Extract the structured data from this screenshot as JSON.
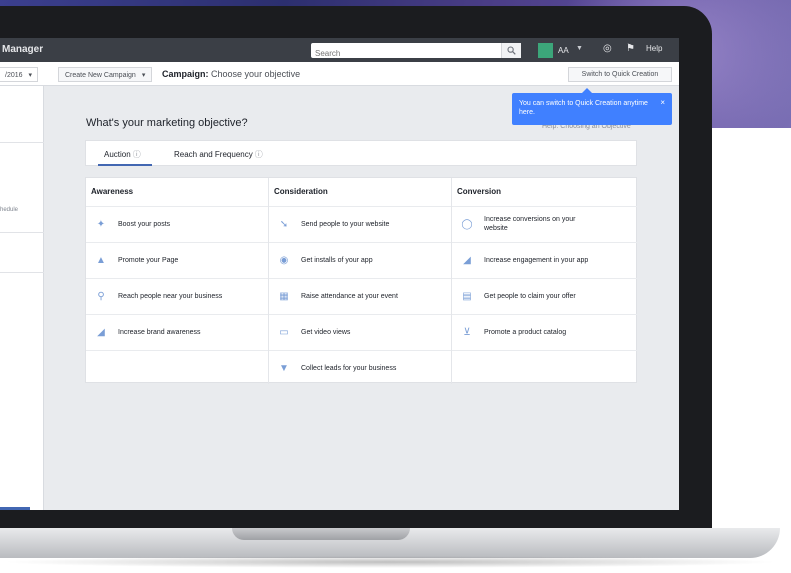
{
  "topbar": {
    "brand": "Manager",
    "search_placeholder": "Search",
    "account_label": "AA",
    "help_label": "Help"
  },
  "subbar": {
    "left_select": "/2016",
    "create_campaign": "Create New Campaign",
    "campaign_prefix": "Campaign:",
    "campaign_text": "Choose your objective",
    "quick_creation": "Switch to Quick Creation"
  },
  "sidebar": {
    "item_text": "hedule"
  },
  "tooltip": {
    "text": "You can switch to Quick Creation anytime here.",
    "close": "×"
  },
  "learn_more": "Help: Choosing an Objective",
  "question": "What's your marketing objective?",
  "tabs": [
    {
      "label": "Auction",
      "info": "ⓘ"
    },
    {
      "label": "Reach and Frequency",
      "info": "ⓘ"
    }
  ],
  "columns": [
    {
      "header": "Awareness",
      "items": [
        {
          "label": "Boost your posts",
          "icon": "boost-icon"
        },
        {
          "label": "Promote your Page",
          "icon": "thumbs-up-icon"
        },
        {
          "label": "Reach people near your business",
          "icon": "location-pin-icon"
        },
        {
          "label": "Increase brand awareness",
          "icon": "megaphone-icon"
        }
      ]
    },
    {
      "header": "Consideration",
      "items": [
        {
          "label": "Send people to your website",
          "icon": "cursor-icon"
        },
        {
          "label": "Get installs of your app",
          "icon": "app-install-icon"
        },
        {
          "label": "Raise attendance at your event",
          "icon": "calendar-icon"
        },
        {
          "label": "Get video views",
          "icon": "video-icon"
        },
        {
          "label": "Collect leads for your business",
          "icon": "funnel-icon"
        }
      ]
    },
    {
      "header": "Conversion",
      "items": [
        {
          "label": "Increase conversions on your website",
          "icon": "globe-icon"
        },
        {
          "label": "Increase engagement in your app",
          "icon": "megaphone-icon"
        },
        {
          "label": "Get people to claim your offer",
          "icon": "offer-icon"
        },
        {
          "label": "Promote a product catalog",
          "icon": "cart-icon"
        }
      ]
    }
  ]
}
